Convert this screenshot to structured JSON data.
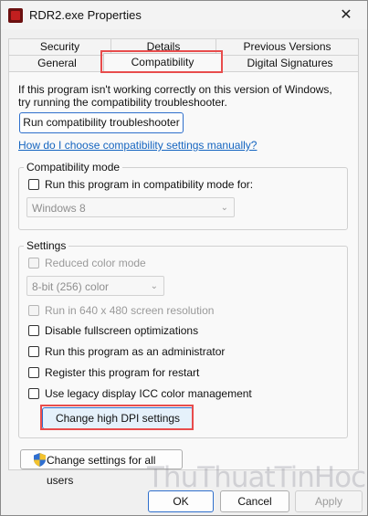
{
  "window": {
    "title": "RDR2.exe Properties",
    "close_glyph": "✕"
  },
  "tabs": {
    "row1": [
      "Security",
      "Details",
      "Previous Versions"
    ],
    "row2": [
      "General",
      "Compatibility",
      "Digital Signatures"
    ],
    "active": "Compatibility"
  },
  "intro": {
    "text": "If this program isn't working correctly on this version of Windows, try running the compatibility troubleshooter.",
    "troubleshoot_button": "Run compatibility troubleshooter",
    "help_link": "How do I choose compatibility settings manually?"
  },
  "compat_mode": {
    "group_label": "Compatibility mode",
    "checkbox_label": "Run this program in compatibility mode for:",
    "os_select_value": "Windows 8"
  },
  "settings": {
    "group_label": "Settings",
    "reduced_color": "Reduced color mode",
    "color_select_value": "8-bit (256) color",
    "run_640": "Run in 640 x 480 screen resolution",
    "disable_fullscreen": "Disable fullscreen optimizations",
    "run_admin": "Run this program as an administrator",
    "register_restart": "Register this program for restart",
    "legacy_icc": "Use legacy display ICC color management",
    "dpi_button": "Change high DPI settings"
  },
  "footer": {
    "all_users_button": "Change settings for all users",
    "ok": "OK",
    "cancel": "Cancel",
    "apply": "Apply"
  },
  "watermark": "ThuThuatTinHoc.vn",
  "colors": {
    "highlight": "#e84c4c",
    "link": "#1565c0",
    "focus": "#2e6fcc"
  }
}
